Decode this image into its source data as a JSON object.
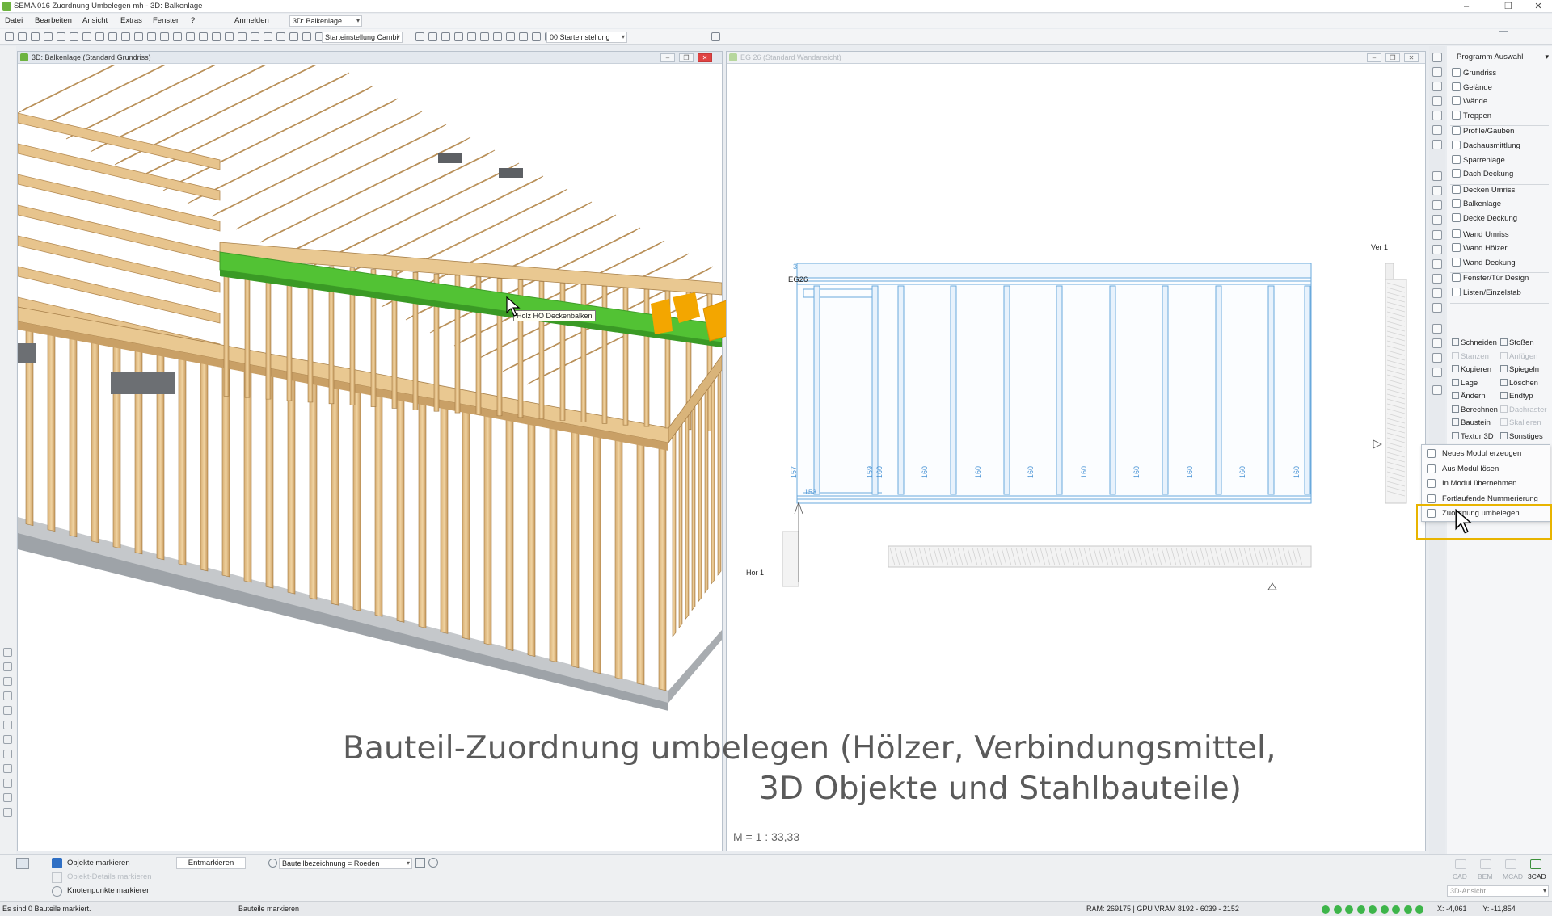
{
  "window": {
    "title": "SEMA  016 Zuordnung Umbelegen mh - 3D: Balkenlage",
    "min": "‒",
    "max": "❐",
    "close": "✕"
  },
  "menu": {
    "items": [
      "Datei",
      "Bearbeiten",
      "Ansicht",
      "Extras",
      "Fenster",
      "?",
      "Anmelden"
    ],
    "view_combo": "3D: Balkenlage"
  },
  "toolbar": {
    "preset_combo": "Starteinstellung Cambi",
    "layer_combo": "00 Starteinstellung"
  },
  "panel3d": {
    "title": "3D: Balkenlage (Standard Grundriss)",
    "tooltip": "Holz HO Deckenbalken"
  },
  "panelwall": {
    "title": "EG 26 (Standard Wandansicht)",
    "wall_name": "EG26",
    "top_label": "3",
    "ver_label": "Ver 1",
    "hor_label": "Hor 1",
    "scale": "M = 1 : 33,33",
    "dims": [
      "157",
      "153",
      "159",
      "160",
      "160",
      "160",
      "160",
      "160",
      "160",
      "160",
      "160",
      "160"
    ]
  },
  "program": {
    "title": "Programm Auswahl",
    "groups": [
      [
        "Grundriss",
        "Gelände",
        "Wände",
        "Treppen"
      ],
      [
        "Profile/Gauben",
        "Dachausmittlung",
        "Sparrenlage",
        "Dach Deckung"
      ],
      [
        "Decken Umriss",
        "Balkenlage",
        "Decke Deckung"
      ],
      [
        "Wand Umriss",
        "Wand Hölzer",
        "Wand Deckung"
      ],
      [
        "Fenster/Tür Design",
        "Listen/Einzelstab"
      ]
    ],
    "tools": [
      {
        "l": "Schneiden",
        "r": "Stoßen",
        "ld": false,
        "rd": false
      },
      {
        "l": "Stanzen",
        "r": "Anfügen",
        "ld": true,
        "rd": true
      },
      {
        "l": "Kopieren",
        "r": "Spiegeln",
        "ld": false,
        "rd": false
      },
      {
        "l": "Lage",
        "r": "Löschen",
        "ld": false,
        "rd": false
      },
      {
        "l": "Ändern",
        "r": "Endtyp",
        "ld": false,
        "rd": false
      },
      {
        "l": "Berechnen",
        "r": "Dachraster",
        "ld": false,
        "rd": true
      },
      {
        "l": "Baustein",
        "r": "Skalieren",
        "ld": false,
        "rd": true
      },
      {
        "l": "Textur 3D",
        "r": "Sonstiges",
        "ld": false,
        "rd": false
      }
    ]
  },
  "popup": {
    "items": [
      "Neues Modul erzeugen",
      "Aus Modul lösen",
      "In Modul übernehmen",
      "Fortlaufende Nummerierung",
      "Zuordnung umbelegen"
    ],
    "highlight": "#e8b400"
  },
  "caption": {
    "line1": "Bauteil-Zuordnung umbelegen (Hölzer, Verbindungsmittel,",
    "line2": "3D Objekte und Stahlbauteile)"
  },
  "bottom": {
    "objekte_markieren": "Objekte markieren",
    "objekt_details": "Objekt-Details markieren",
    "knotenpunkte": "Knotenpunkte markieren",
    "entmarkieren": "Entmarkieren",
    "filter_combo": "Bauteilbezeichnung = Roeden",
    "modes": [
      "CAD",
      "BEM",
      "MCAD",
      "3CAD"
    ],
    "view_combo": "3D-Ansicht"
  },
  "status": {
    "left": "Es sind 0 Bauteile markiert.",
    "mid": "Bauteile markieren",
    "ram": "RAM: 269175 | GPU VRAM 8192 - 6039 - 2152",
    "coords": "X: -4,061        Y: -11,854"
  },
  "colors": {
    "accent_green": "#52c234",
    "arrow_orange": "#f3a600",
    "wood": "#e6c38e",
    "blueprint": "#6aa9dc"
  }
}
